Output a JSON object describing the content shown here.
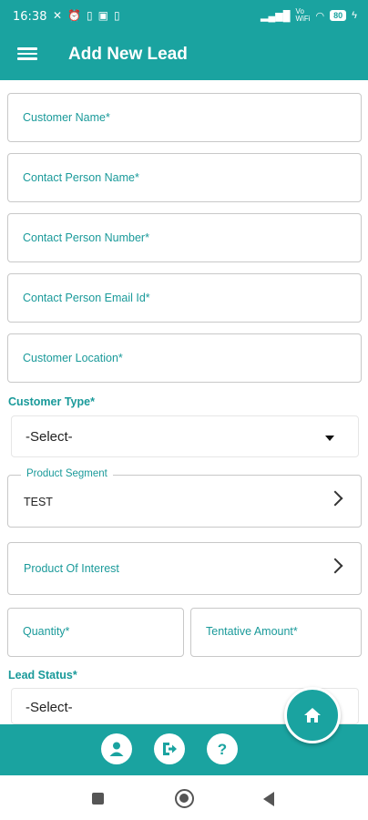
{
  "status_bar": {
    "time": "16:38",
    "left_icons": [
      "wifi-off-icon",
      "alarm-icon",
      "sim-icon",
      "sd-card-icon",
      "sim-icon"
    ],
    "network_label": "Vo WiFi",
    "battery": "80"
  },
  "app_bar": {
    "title": "Add New Lead",
    "menu_icon": "hamburger-menu-icon"
  },
  "form": {
    "customer_name": "Customer Name*",
    "contact_person_name": "Contact Person Name*",
    "contact_person_number": "Contact Person Number*",
    "contact_person_email": "Contact Person Email Id*",
    "customer_location": "Customer Location*",
    "customer_type": {
      "label": "Customer Type*",
      "value": "-Select-"
    },
    "product_segment": {
      "label": "Product Segment",
      "value": "TEST"
    },
    "product_of_interest": "Product Of Interest",
    "quantity": "Quantity*",
    "tentative_amount": "Tentative Amount*",
    "lead_status": {
      "label": "Lead Status*",
      "value": "-Select-"
    }
  },
  "bottom_bar": {
    "icons": [
      "profile-icon",
      "logout-icon",
      "help-icon"
    ],
    "fab_icon": "home-icon"
  },
  "colors": {
    "primary": "#1aa3a0",
    "label": "#1a9a9a",
    "border": "#c8c8c8"
  }
}
